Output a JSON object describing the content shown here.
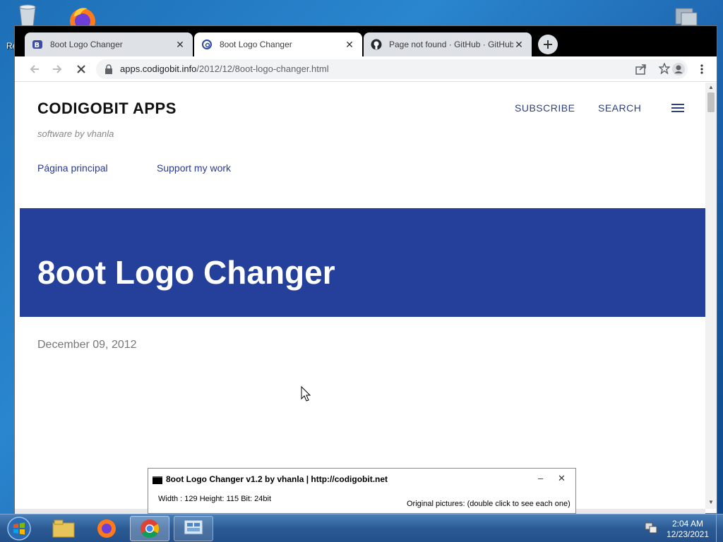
{
  "desktop": {
    "left_label": "Re"
  },
  "tabs": [
    {
      "title": "8oot Logo Changer",
      "icon": "blogger-icon"
    },
    {
      "title": "8oot Logo Changer",
      "icon": "codigobit-icon"
    },
    {
      "title": "Page not found · GitHub · GitHub",
      "icon": "github-icon"
    }
  ],
  "toolbar": {
    "url_host": "apps.codigobit.info",
    "url_path": "/2012/12/8oot-logo-changer.html"
  },
  "site": {
    "title": "CODIGOBIT APPS",
    "description": "software by vhanla",
    "subscribe": "SUBSCRIBE",
    "search": "SEARCH",
    "nav": [
      "Página principal",
      "Support my work"
    ]
  },
  "post": {
    "title": "8oot Logo Changer",
    "date": "December 09, 2012"
  },
  "app_window": {
    "title": "8oot Logo Changer v1.2 by vhanla | http://codigobit.net",
    "info": "Width : 129 Height: 115 Bit: 24bit",
    "original": "Original pictures: (double click to see each one)"
  },
  "clock": {
    "time": "2:04 AM",
    "date": "12/23/2021"
  },
  "colors": {
    "hero": "#24409a",
    "link": "#2a3a8f"
  }
}
